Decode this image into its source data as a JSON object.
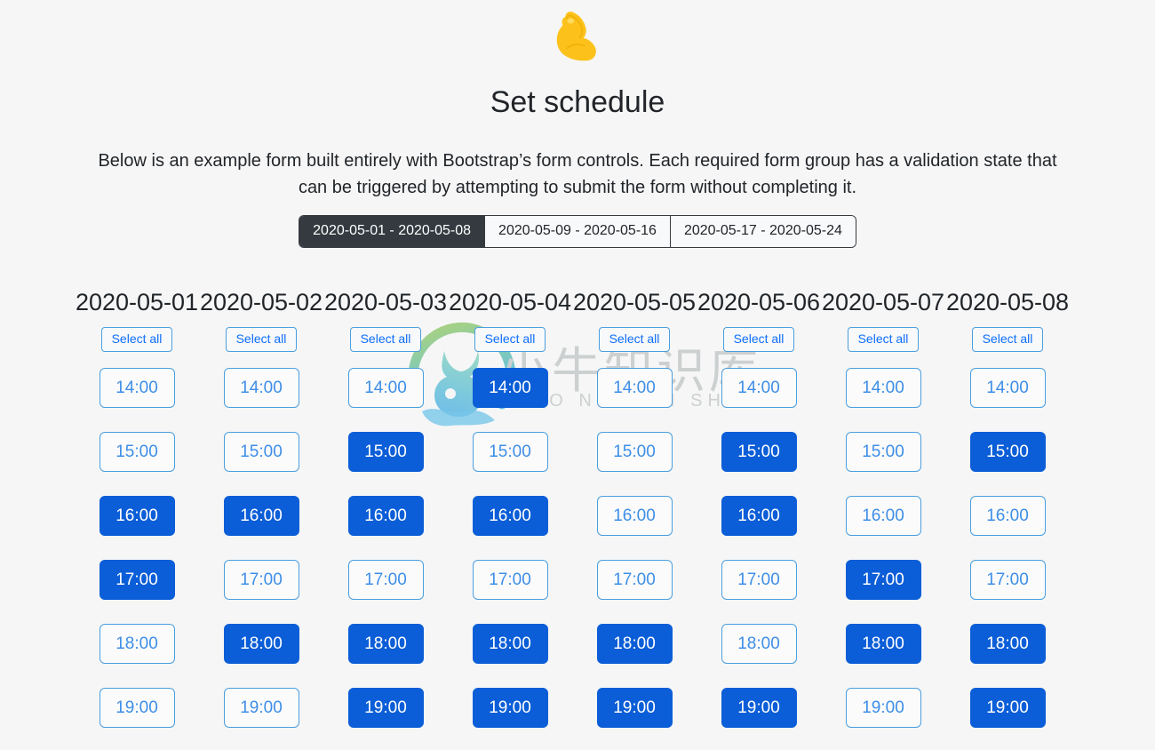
{
  "header": {
    "emoji_icon": "flexed-biceps-emoji",
    "title": "Set schedule",
    "description": "Below is an example form built entirely with Bootstrap’s form controls. Each required form group has a validation state that can be triggered by attempting to submit the form without completing it."
  },
  "watermark": {
    "logo_icon": "bull-head-circle-logo",
    "text_cn": "小牛知识库",
    "text_en": "XIAO NIU ZHI SHI KU",
    "color": "#c9cdcd"
  },
  "tabs": {
    "active_index": 0,
    "items": [
      {
        "label": "2020-05-01 - 2020-05-08",
        "active": true
      },
      {
        "label": "2020-05-09 - 2020-05-16",
        "active": false
      },
      {
        "label": "2020-05-17 - 2020-05-24",
        "active": false
      }
    ]
  },
  "schedule": {
    "select_all_label": "Select all",
    "times": [
      "14:00",
      "15:00",
      "16:00",
      "17:00",
      "18:00",
      "19:00"
    ],
    "selected_color": "#0b5ed7",
    "unselected_color": "#3e8ee8",
    "days": [
      {
        "date": "2020-05-01",
        "slots": [
          {
            "time": "14:00",
            "selected": false
          },
          {
            "time": "15:00",
            "selected": false
          },
          {
            "time": "16:00",
            "selected": true
          },
          {
            "time": "17:00",
            "selected": true
          },
          {
            "time": "18:00",
            "selected": false
          },
          {
            "time": "19:00",
            "selected": false
          }
        ]
      },
      {
        "date": "2020-05-02",
        "slots": [
          {
            "time": "14:00",
            "selected": false
          },
          {
            "time": "15:00",
            "selected": false
          },
          {
            "time": "16:00",
            "selected": true
          },
          {
            "time": "17:00",
            "selected": false
          },
          {
            "time": "18:00",
            "selected": true
          },
          {
            "time": "19:00",
            "selected": false
          }
        ]
      },
      {
        "date": "2020-05-03",
        "slots": [
          {
            "time": "14:00",
            "selected": false
          },
          {
            "time": "15:00",
            "selected": true
          },
          {
            "time": "16:00",
            "selected": true
          },
          {
            "time": "17:00",
            "selected": false
          },
          {
            "time": "18:00",
            "selected": true
          },
          {
            "time": "19:00",
            "selected": true
          }
        ]
      },
      {
        "date": "2020-05-04",
        "slots": [
          {
            "time": "14:00",
            "selected": true
          },
          {
            "time": "15:00",
            "selected": false
          },
          {
            "time": "16:00",
            "selected": true
          },
          {
            "time": "17:00",
            "selected": false
          },
          {
            "time": "18:00",
            "selected": true
          },
          {
            "time": "19:00",
            "selected": true
          }
        ]
      },
      {
        "date": "2020-05-05",
        "slots": [
          {
            "time": "14:00",
            "selected": false
          },
          {
            "time": "15:00",
            "selected": false
          },
          {
            "time": "16:00",
            "selected": false
          },
          {
            "time": "17:00",
            "selected": false
          },
          {
            "time": "18:00",
            "selected": true
          },
          {
            "time": "19:00",
            "selected": true
          }
        ]
      },
      {
        "date": "2020-05-06",
        "slots": [
          {
            "time": "14:00",
            "selected": false
          },
          {
            "time": "15:00",
            "selected": true
          },
          {
            "time": "16:00",
            "selected": true
          },
          {
            "time": "17:00",
            "selected": false
          },
          {
            "time": "18:00",
            "selected": false
          },
          {
            "time": "19:00",
            "selected": true
          }
        ]
      },
      {
        "date": "2020-05-07",
        "slots": [
          {
            "time": "14:00",
            "selected": false
          },
          {
            "time": "15:00",
            "selected": false
          },
          {
            "time": "16:00",
            "selected": false
          },
          {
            "time": "17:00",
            "selected": true
          },
          {
            "time": "18:00",
            "selected": true
          },
          {
            "time": "19:00",
            "selected": false
          }
        ]
      },
      {
        "date": "2020-05-08",
        "slots": [
          {
            "time": "14:00",
            "selected": false
          },
          {
            "time": "15:00",
            "selected": true
          },
          {
            "time": "16:00",
            "selected": false
          },
          {
            "time": "17:00",
            "selected": false
          },
          {
            "time": "18:00",
            "selected": true
          },
          {
            "time": "19:00",
            "selected": true
          }
        ]
      }
    ]
  }
}
